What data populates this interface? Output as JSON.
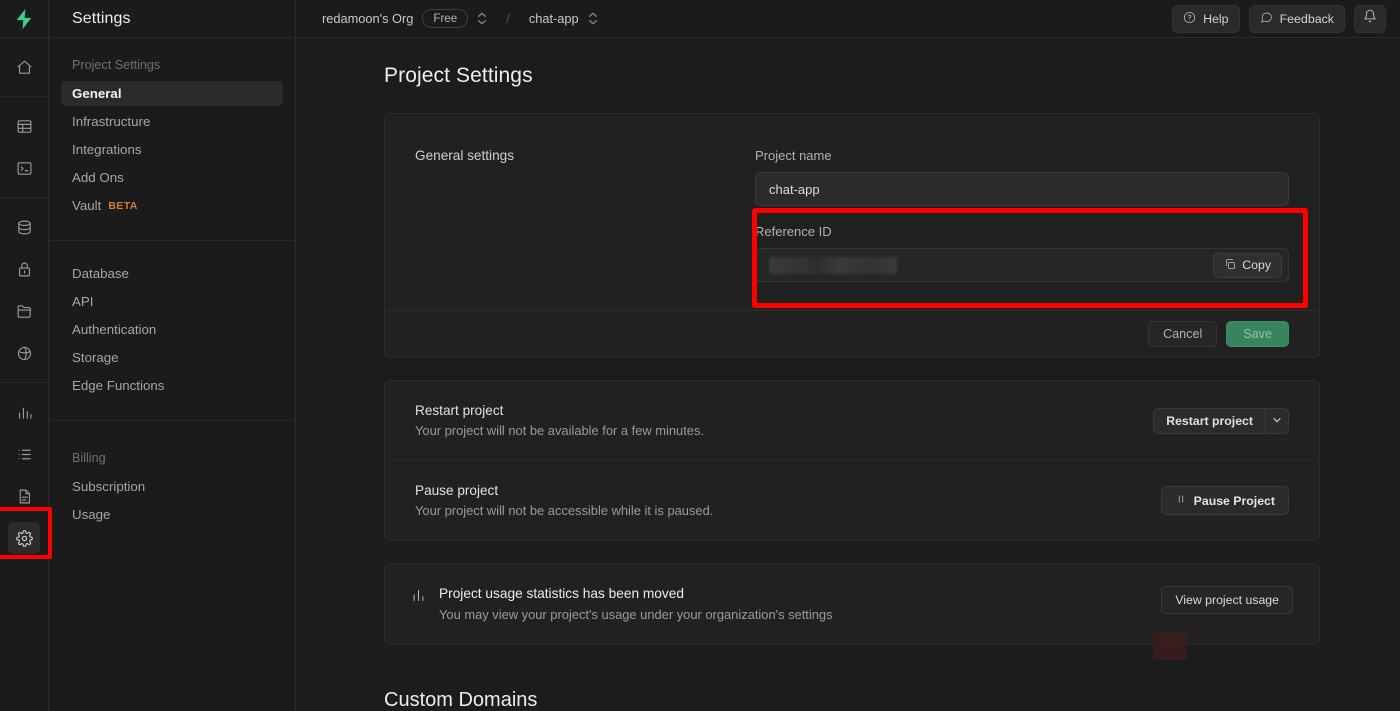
{
  "rail": {
    "logo_icon": "supabase-logo-icon",
    "groups": [
      [
        {
          "icon": "home-icon",
          "name": "rail-home"
        }
      ],
      [
        {
          "icon": "table-editor-icon",
          "name": "rail-table-editor"
        },
        {
          "icon": "sql-editor-icon",
          "name": "rail-sql-editor"
        }
      ],
      [
        {
          "icon": "database-icon",
          "name": "rail-database"
        },
        {
          "icon": "auth-lock-icon",
          "name": "rail-authentication"
        },
        {
          "icon": "storage-icon",
          "name": "rail-storage"
        },
        {
          "icon": "edge-functions-icon",
          "name": "rail-edge-functions"
        }
      ],
      [
        {
          "icon": "reports-chart-icon",
          "name": "rail-reports"
        },
        {
          "icon": "logs-list-icon",
          "name": "rail-logs"
        },
        {
          "icon": "api-docs-icon",
          "name": "rail-api-docs"
        },
        {
          "icon": "gear-icon",
          "name": "rail-project-settings",
          "active": true
        }
      ]
    ]
  },
  "sidebar": {
    "title": "Settings",
    "sections": [
      {
        "label": "Project Settings",
        "items": [
          {
            "label": "General",
            "active": true
          },
          {
            "label": "Infrastructure"
          },
          {
            "label": "Integrations"
          },
          {
            "label": "Add Ons"
          },
          {
            "label": "Vault",
            "badge": "BETA"
          }
        ]
      },
      {
        "label": "",
        "items": [
          {
            "label": "Database"
          },
          {
            "label": "API"
          },
          {
            "label": "Authentication"
          },
          {
            "label": "Storage"
          },
          {
            "label": "Edge Functions"
          }
        ]
      },
      {
        "label": "Billing",
        "items": [
          {
            "label": "Subscription"
          },
          {
            "label": "Usage"
          }
        ]
      }
    ]
  },
  "topbar": {
    "org_name": "redamoon's Org",
    "plan_badge": "Free",
    "separator": "/",
    "project_name": "chat-app",
    "help_label": "Help",
    "feedback_label": "Feedback",
    "notification_icon": "bell-icon"
  },
  "main": {
    "page_title": "Project Settings",
    "general": {
      "section_label": "General settings",
      "project_name_label": "Project name",
      "project_name_value": "chat-app",
      "reference_id_label": "Reference ID",
      "reference_id_value": "",
      "copy_label": "Copy",
      "cancel_label": "Cancel",
      "save_label": "Save"
    },
    "restart": {
      "title": "Restart project",
      "desc": "Your project will not be available for a few minutes.",
      "button_label": "Restart project"
    },
    "pause": {
      "title": "Pause project",
      "desc": "Your project will not be accessible while it is paused.",
      "button_label": "Pause Project"
    },
    "usage_notice": {
      "title": "Project usage statistics has been moved",
      "desc": "You may view your project's usage under your organization's settings",
      "button_label": "View project usage"
    },
    "custom_domains_heading": "Custom Domains"
  },
  "colors": {
    "accent_green": "#3ecf8e",
    "highlight_red": "#ff0000",
    "beta_orange": "#d97c2b",
    "page_bg": "#1c1c1c",
    "card_bg": "#212121"
  }
}
